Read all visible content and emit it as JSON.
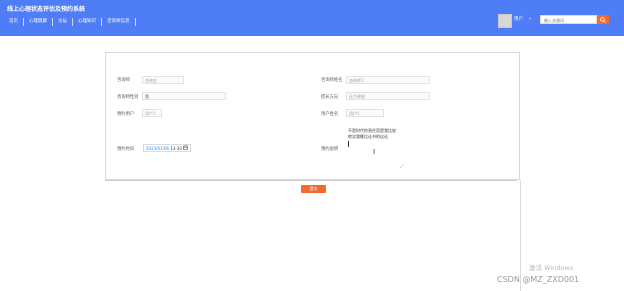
{
  "header": {
    "title": "线上心理状态评估及预约系统",
    "nav": [
      "首页",
      "心理健康",
      "论坛",
      "心理知识",
      "咨询师信息"
    ],
    "user_label": "用户",
    "user_caret": "⌄",
    "search_placeholder": "输入关键词",
    "accent_color": "#4f7cf7",
    "button_color": "#f26b2d"
  },
  "form": {
    "fields": [
      {
        "label": "咨询师",
        "value": "咨询名"
      },
      {
        "label": "咨询师姓名",
        "value": "咨询师1"
      },
      {
        "label": "咨询师性别",
        "value": "男"
      },
      {
        "label": "擅长方向",
        "value": "压力释放"
      },
      {
        "label": "预约用户",
        "value": "用户1"
      },
      {
        "label": "用户姓名",
        "value": "用户1"
      },
      {
        "label": "预约时间",
        "date_value": "2023/01/06",
        "time_value": "13:30"
      },
      {
        "label": "预约说明",
        "value": "不是时代的责任而是我们身上有许多的东西确实比不上你"
      }
    ],
    "textarea_lines": [
      "不是时代的责任而是我比较",
      "转次我撕比论书的议论"
    ],
    "submit_label": "提交"
  },
  "overlay": {
    "activate_windows": "激活 Windows",
    "watermark": "CSDN @MZ_ZXD001"
  }
}
